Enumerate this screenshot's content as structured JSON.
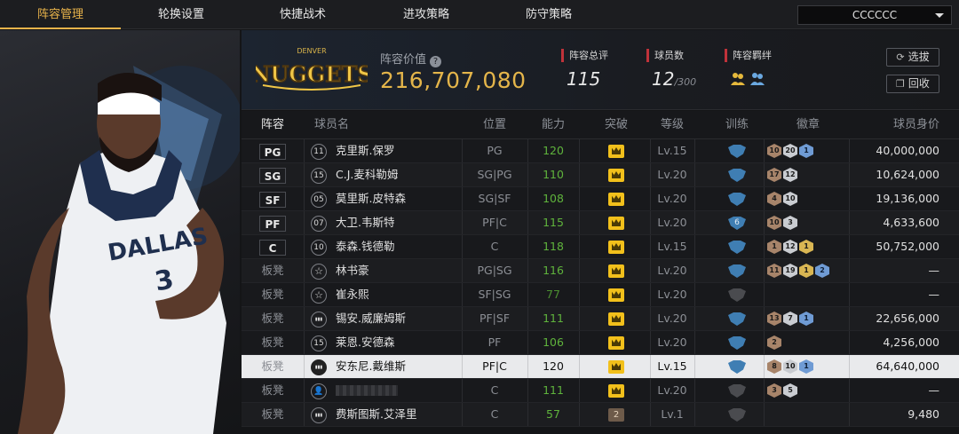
{
  "tabs": [
    "阵容管理",
    "轮换设置",
    "快捷战术",
    "进攻策略",
    "防守策略"
  ],
  "active_tab": 0,
  "user_select": {
    "value": "CCCCCC"
  },
  "team": {
    "logo_text": "NUGGETS",
    "logo_sub": "DENVER",
    "value_label": "阵容价值",
    "value": "216,707,080",
    "stats": {
      "rating_label": "阵容总评",
      "rating": "115",
      "players_label": "球员数",
      "players": "12",
      "players_max": "/300",
      "bond_label": "阵容羁绊"
    },
    "buttons": {
      "select": "选拔",
      "recycle": "回收"
    }
  },
  "table": {
    "headers": [
      "阵容",
      "球员名",
      "位置",
      "能力",
      "突破",
      "等级",
      "训练",
      "徽章",
      "球员身价"
    ],
    "rows": [
      {
        "slot": "PG",
        "starter": true,
        "icon": "11",
        "name": "克里斯.保罗",
        "pos": "PG",
        "ability": "120",
        "breakthrough": "crown",
        "level": "Lv.15",
        "training": "blue",
        "badges": [
          [
            "bronze",
            "10"
          ],
          [
            "silver",
            "20"
          ],
          [
            "blue",
            "1"
          ]
        ],
        "salary": "40,000,000"
      },
      {
        "slot": "SG",
        "starter": true,
        "icon": "15",
        "name": "C.J.麦科勒姆",
        "pos": "SG|PG",
        "ability": "110",
        "breakthrough": "crown",
        "level": "Lv.20",
        "training": "blue",
        "badges": [
          [
            "bronze",
            "17"
          ],
          [
            "silver",
            "12"
          ]
        ],
        "salary": "10,624,000"
      },
      {
        "slot": "SF",
        "starter": true,
        "icon": "05",
        "name": "莫里斯.皮特森",
        "pos": "SG|SF",
        "ability": "108",
        "breakthrough": "crown",
        "level": "Lv.20",
        "training": "blue",
        "badges": [
          [
            "bronze",
            "4"
          ],
          [
            "silver",
            "10"
          ]
        ],
        "salary": "19,136,000"
      },
      {
        "slot": "PF",
        "starter": true,
        "icon": "07",
        "name": "大卫.韦斯特",
        "pos": "PF|C",
        "ability": "115",
        "breakthrough": "crown",
        "level": "Lv.20",
        "training": "blue-6",
        "badges": [
          [
            "bronze",
            "10"
          ],
          [
            "silver",
            "3"
          ]
        ],
        "salary": "4,633,600"
      },
      {
        "slot": "C",
        "starter": true,
        "icon": "10",
        "name": "泰森.钱德勒",
        "pos": "C",
        "ability": "118",
        "breakthrough": "crown",
        "level": "Lv.15",
        "training": "blue",
        "badges": [
          [
            "bronze",
            "1"
          ],
          [
            "silver",
            "12"
          ],
          [
            "gold",
            "1"
          ]
        ],
        "salary": "50,752,000"
      },
      {
        "slot": "板凳",
        "starter": false,
        "icon": "star",
        "name": "林书豪",
        "pos": "PG|SG",
        "ability": "116",
        "breakthrough": "crown",
        "level": "Lv.20",
        "training": "blue",
        "badges": [
          [
            "bronze",
            "11"
          ],
          [
            "silver",
            "19"
          ],
          [
            "gold",
            "1"
          ],
          [
            "blue",
            "2"
          ]
        ],
        "salary": "—"
      },
      {
        "slot": "板凳",
        "starter": false,
        "icon": "star",
        "name": "崔永熙",
        "pos": "SF|SG",
        "ability": "77",
        "breakthrough": "crown",
        "level": "Lv.20",
        "training": "gray",
        "badges": [],
        "salary": "—"
      },
      {
        "slot": "板凳",
        "starter": false,
        "icon": "bars",
        "name": "锡安.威廉姆斯",
        "pos": "PF|SF",
        "ability": "111",
        "breakthrough": "crown",
        "level": "Lv.20",
        "training": "blue",
        "badges": [
          [
            "bronze",
            "13"
          ],
          [
            "silver",
            "7"
          ],
          [
            "blue",
            "1"
          ]
        ],
        "salary": "22,656,000"
      },
      {
        "slot": "板凳",
        "starter": false,
        "icon": "15",
        "name": "莱恩.安德森",
        "pos": "PF",
        "ability": "106",
        "breakthrough": "crown",
        "level": "Lv.20",
        "training": "blue",
        "badges": [
          [
            "bronze",
            "2"
          ]
        ],
        "salary": "4,256,000"
      },
      {
        "slot": "板凳",
        "starter": false,
        "selected": true,
        "icon": "bars",
        "name": "安东尼.戴维斯",
        "pos": "PF|C",
        "ability": "120",
        "breakthrough": "crown",
        "level": "Lv.15",
        "training": "blue",
        "badges": [
          [
            "bronze",
            "8"
          ],
          [
            "silver",
            "10"
          ],
          [
            "blue",
            "1"
          ]
        ],
        "salary": "64,640,000"
      },
      {
        "slot": "板凳",
        "starter": false,
        "icon": "person",
        "name": "",
        "pos": "C",
        "ability": "111",
        "breakthrough": "crown",
        "level": "Lv.20",
        "training": "gray",
        "badges": [
          [
            "bronze",
            "3"
          ],
          [
            "silver",
            "5"
          ]
        ],
        "salary": "—"
      },
      {
        "slot": "板凳",
        "starter": false,
        "icon": "bars",
        "name": "费斯图斯.艾泽里",
        "pos": "C",
        "ability": "57",
        "breakthrough": "2",
        "level": "Lv.1",
        "training": "gray",
        "badges": [],
        "salary": "9,480"
      }
    ]
  },
  "colors": {
    "accent": "#e8b34a",
    "ability": "#5fb33c",
    "crown": "#f2c01b",
    "stat_marker": "#c0323a"
  }
}
